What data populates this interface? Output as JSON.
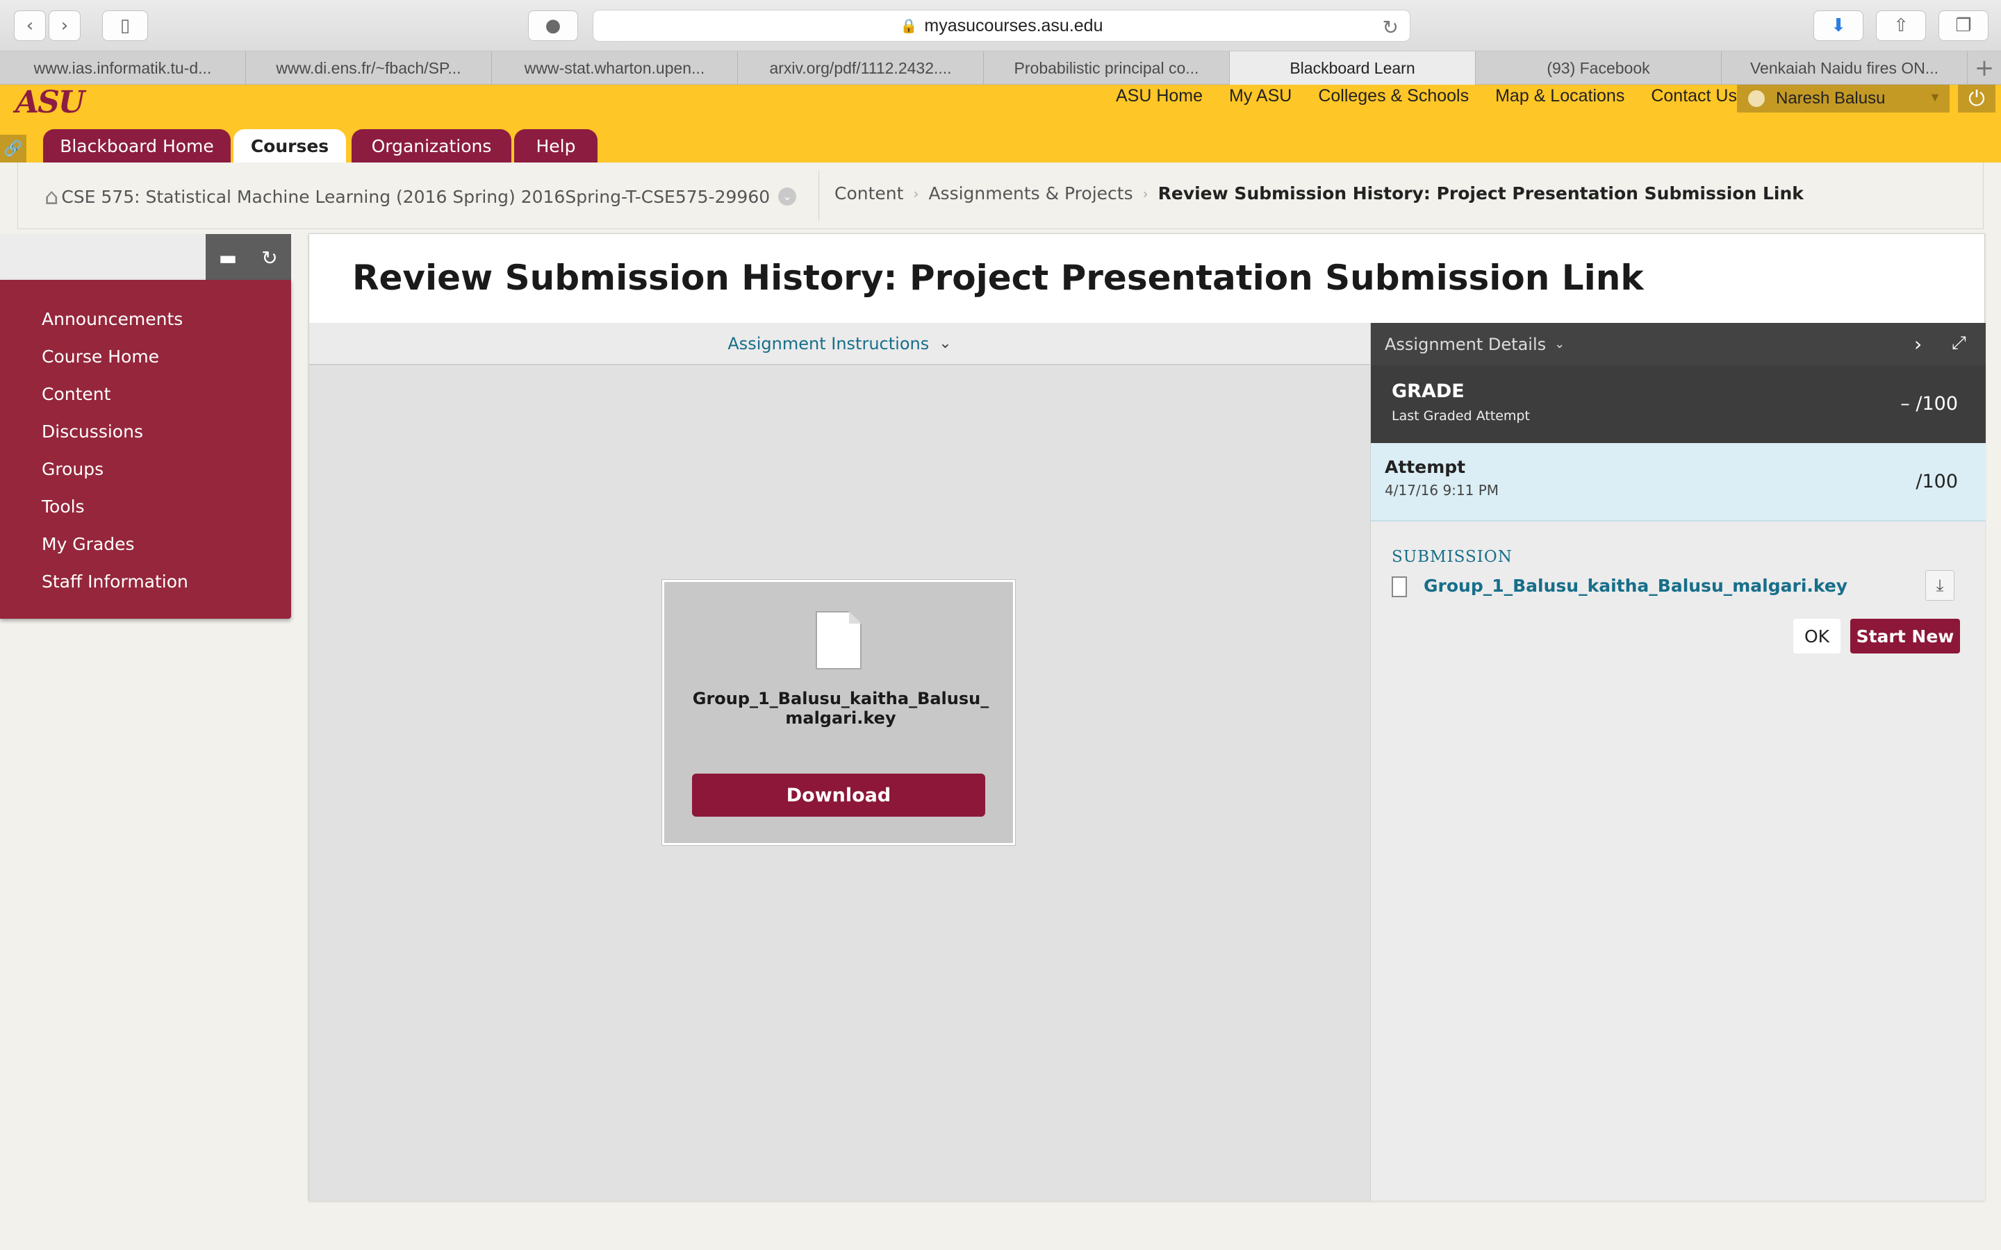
{
  "browser": {
    "url": "myasucourses.asu.edu",
    "tabs": [
      {
        "label": "www.ias.informatik.tu-d..."
      },
      {
        "label": "www.di.ens.fr/~fbach/SP..."
      },
      {
        "label": "www-stat.wharton.upen..."
      },
      {
        "label": "arxiv.org/pdf/1112.2432...."
      },
      {
        "label": "Probabilistic principal co..."
      },
      {
        "label": "Blackboard Learn"
      },
      {
        "label": "(93) Facebook"
      },
      {
        "label": "Venkaiah Naidu fires ON..."
      }
    ],
    "new_tab_label": "+"
  },
  "header": {
    "logo": "ASU",
    "links": [
      "ASU Home",
      "My ASU",
      "Colleges & Schools",
      "Map & Locations",
      "Contact Us"
    ],
    "user_name": "Naresh Balusu",
    "nav_tabs": [
      "Blackboard Home",
      "Courses",
      "Organizations",
      "Help"
    ],
    "active_tab": "Courses",
    "brand_color": "#8c1d40",
    "gold_color": "#ffc627"
  },
  "breadcrumb": {
    "course": "CSE 575: Statistical Machine Learning (2016 Spring) 2016Spring-T-CSE575-29960",
    "items": [
      "Content",
      "Assignments & Projects"
    ],
    "current": "Review Submission History: Project Presentation Submission Link"
  },
  "course_menu": {
    "items": [
      "Announcements",
      "Course Home",
      "Content",
      "Discussions",
      "Groups",
      "Tools",
      "My Grades",
      "Staff Information"
    ]
  },
  "main": {
    "title": "Review Submission History: Project Presentation Submission Link",
    "instructions_label": "Assignment Instructions",
    "file_card": {
      "file_name": "Group_1_Balusu_kaitha_Balusu_malgari.key",
      "download_label": "Download"
    },
    "details": {
      "header_label": "Assignment Details",
      "grade_label": "GRADE",
      "grade_sub": "Last Graded Attempt",
      "grade_score": "– /100",
      "attempt_label": "Attempt",
      "attempt_date": "4/17/16 9:11 PM",
      "attempt_score": "/100",
      "submission_label": "SUBMISSION",
      "submission_file": "Group_1_Balusu_kaitha_Balusu_malgari.key",
      "ok_label": "OK",
      "start_new_label": "Start New"
    }
  }
}
